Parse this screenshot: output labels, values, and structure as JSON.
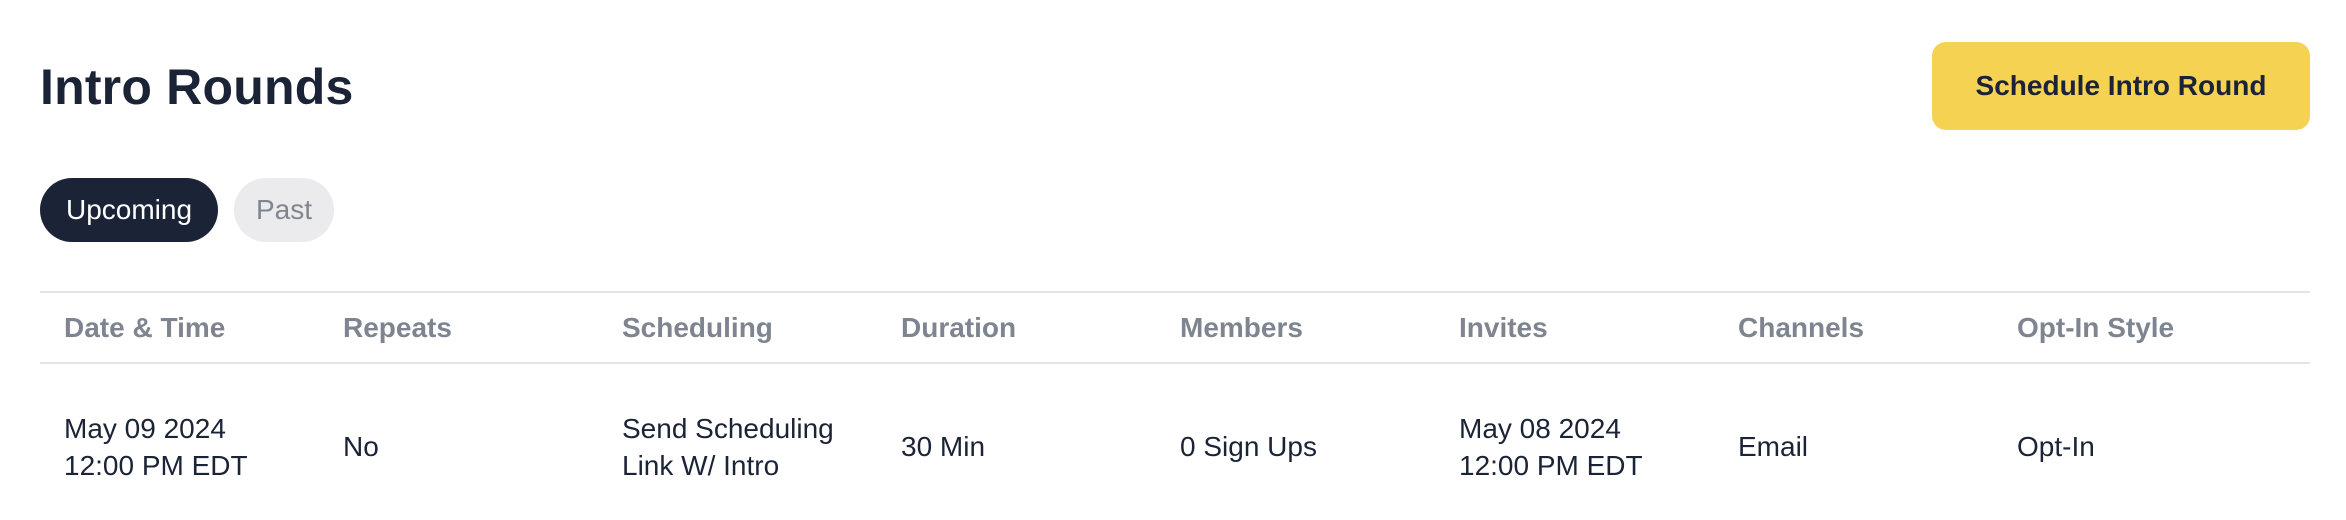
{
  "header": {
    "title": "Intro Rounds",
    "schedule_button_label": "Schedule Intro Round"
  },
  "tabs": [
    {
      "label": "Upcoming",
      "active": true
    },
    {
      "label": "Past",
      "active": false
    }
  ],
  "table": {
    "columns": [
      "Date & Time",
      "Repeats",
      "Scheduling",
      "Duration",
      "Members",
      "Invites",
      "Channels",
      "Opt-In Style"
    ],
    "rows": [
      {
        "date_line1": "May 09 2024",
        "date_line2": "12:00 PM EDT",
        "repeats": "No",
        "scheduling_line1": "Send Scheduling",
        "scheduling_line2": "Link W/ Intro",
        "duration": "30 Min",
        "members": "0 Sign Ups",
        "invites_line1": "May 08 2024",
        "invites_line2": "12:00 PM EDT",
        "channels": "Email",
        "opt_in_style": "Opt-In"
      }
    ]
  },
  "colors": {
    "accent_button": "#f6d252",
    "active_tab": "#1b2336",
    "inactive_tab": "#ebebed",
    "header_text": "#7f8590",
    "divider": "#e3e4e7"
  }
}
